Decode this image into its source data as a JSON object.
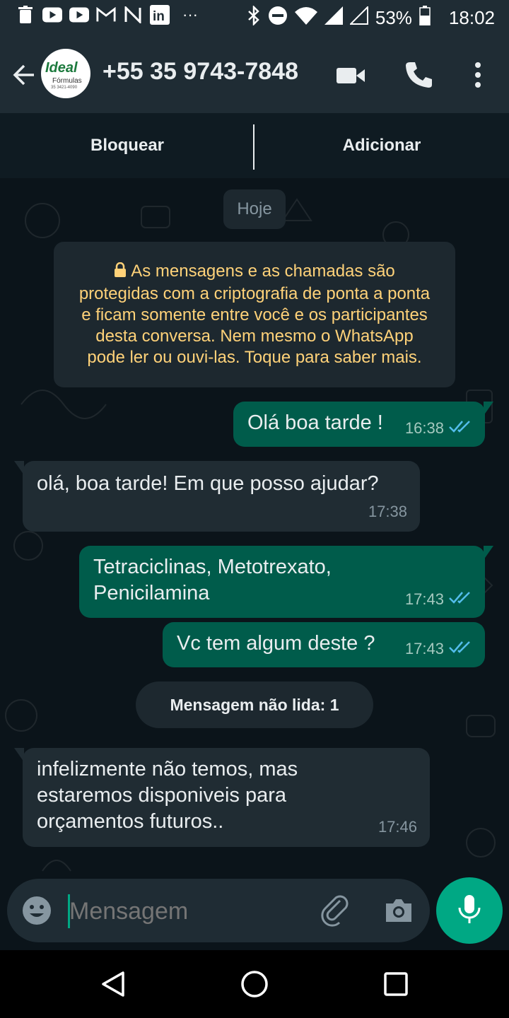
{
  "status_bar": {
    "battery": "53%",
    "time": "18:02",
    "overflow": "···",
    "icons": [
      "trash-icon",
      "youtube-icon",
      "youtube-icon",
      "gmail-icon",
      "nfc-icon",
      "linkedin-icon",
      "bluetooth-icon",
      "dnd-icon",
      "wifi-icon",
      "signal-icon",
      "signal-icon",
      "battery-icon"
    ]
  },
  "header": {
    "contact": "+55 35 9743-7848",
    "avatar_brand": "Ideal",
    "avatar_sub": "Fórmulas",
    "avatar_phone": "35 3421-4090",
    "icons": [
      "back-arrow-icon",
      "video-call-icon",
      "phone-icon",
      "more-vert-icon"
    ]
  },
  "actions": {
    "block": "Bloquear",
    "add": "Adicionar"
  },
  "chat": {
    "date_pill": "Hoje",
    "encryption_notice": "As mensagens e as chamadas são protegidas com a criptografia de ponta a ponta e ficam somente entre você e os participantes desta conversa. Nem mesmo o WhatsApp pode ler ou ouvi-las. Toque para saber mais.",
    "messages": [
      {
        "dir": "out",
        "lines": [
          "Olá boa tarde !"
        ],
        "time": "16:38",
        "ticks": "read"
      },
      {
        "dir": "in",
        "lines": [
          "olá, boa tarde! Em que posso ajudar?"
        ],
        "time": "17:38"
      },
      {
        "dir": "out",
        "lines": [
          "Tetraciclinas, Metotrexato,",
          "Penicilamina"
        ],
        "time": "17:43",
        "ticks": "read"
      },
      {
        "dir": "out",
        "lines": [
          "Vc tem algum deste ?"
        ],
        "time": "17:43",
        "ticks": "read"
      },
      {
        "dir": "in",
        "lines": [
          "infelizmente não temos, mas",
          "estaremos disponiveis para",
          "orçamentos futuros.."
        ],
        "time": "17:46"
      }
    ],
    "unread_label": "Mensagem não lida: 1"
  },
  "composer": {
    "placeholder": "Mensagem",
    "icons": [
      "emoji-icon",
      "attach-icon",
      "camera-icon",
      "mic-icon"
    ]
  },
  "colors": {
    "outgoing": "#005c4b",
    "incoming": "#202c33",
    "accent": "#00a884",
    "notice_text": "#ffd279",
    "read_ticks": "#53bdeb"
  }
}
